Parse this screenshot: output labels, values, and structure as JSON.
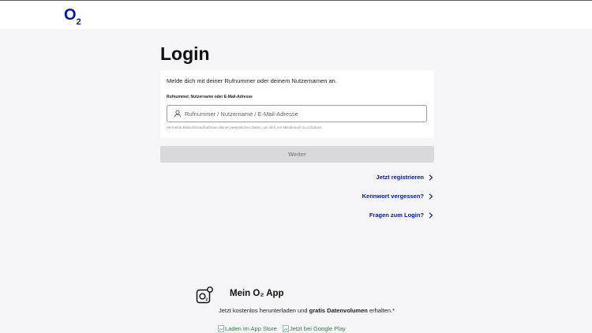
{
  "header": {
    "logo_main": "O",
    "logo_sub": "2"
  },
  "login": {
    "title": "Login",
    "intro": "Melde dich mit deiner Rufnummer oder deinem Nutzernamen an.",
    "field_label": "Rufnummer, Nutzername oder E-Mail-Adresse",
    "placeholder": "Rufnummer / Nutzername / E-Mail-Adresse",
    "hint": "Vermeide Bildschirmaufnahmen deiner persönlichen Daten, um dich vor Missbrauch zu schützen.",
    "submit_label": "Weiter"
  },
  "links": {
    "register": "Jetzt registrieren",
    "forgot_password": "Kennwort vergessen?",
    "faq": "Fragen zum Login?"
  },
  "app": {
    "title": "Mein O₂ App",
    "text_before": "Jetzt kostenlos herunterladen und ",
    "text_bold": "gratis Datenvolumen",
    "text_after": " erhalten.*",
    "app_store_alt": "Laden im App Store",
    "google_play_alt": "Jetzt bei Google Play"
  },
  "colors": {
    "brand": "#0019a5",
    "page_background": "#f5f5f7",
    "button_disabled": "#d9d9dd"
  },
  "icons": {
    "input": "user-icon",
    "links": "chevron-right-icon",
    "app": "o2-app-icon"
  }
}
